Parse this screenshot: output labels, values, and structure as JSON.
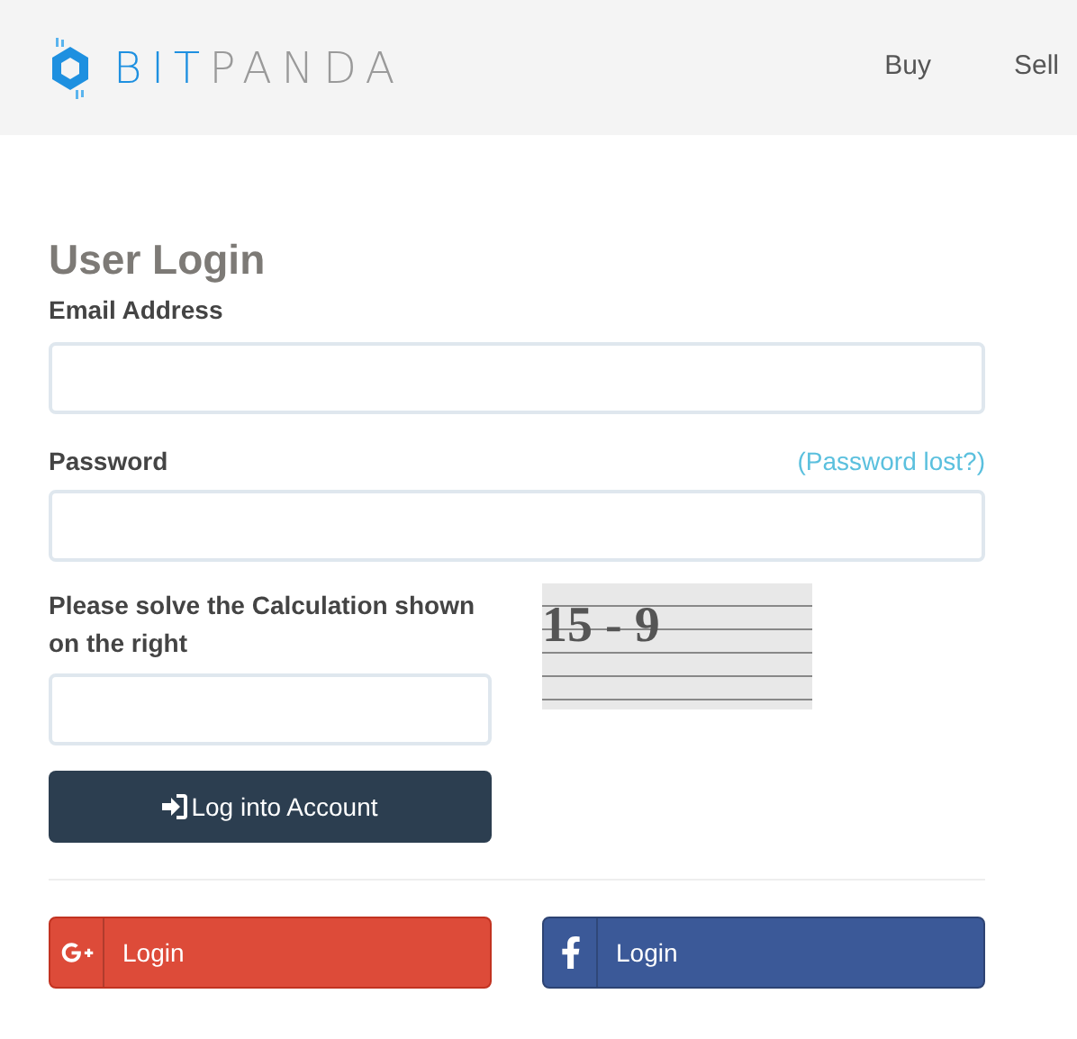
{
  "header": {
    "logo": {
      "part_1": "BIT",
      "part_2": "PANDA"
    },
    "nav": [
      {
        "label": "Buy"
      },
      {
        "label": "Sell"
      }
    ]
  },
  "form": {
    "title": "User Login",
    "email": {
      "label": "Email Address"
    },
    "password": {
      "label": "Password",
      "link": "(Password lost?)"
    },
    "captcha": {
      "label": "Please solve the Calculation shown on the right",
      "challenge": "15 - 9"
    },
    "submit": "Log into Account",
    "social": [
      {
        "kind": "google",
        "label": "Login"
      },
      {
        "kind": "facebook",
        "label": "Login"
      }
    ]
  }
}
